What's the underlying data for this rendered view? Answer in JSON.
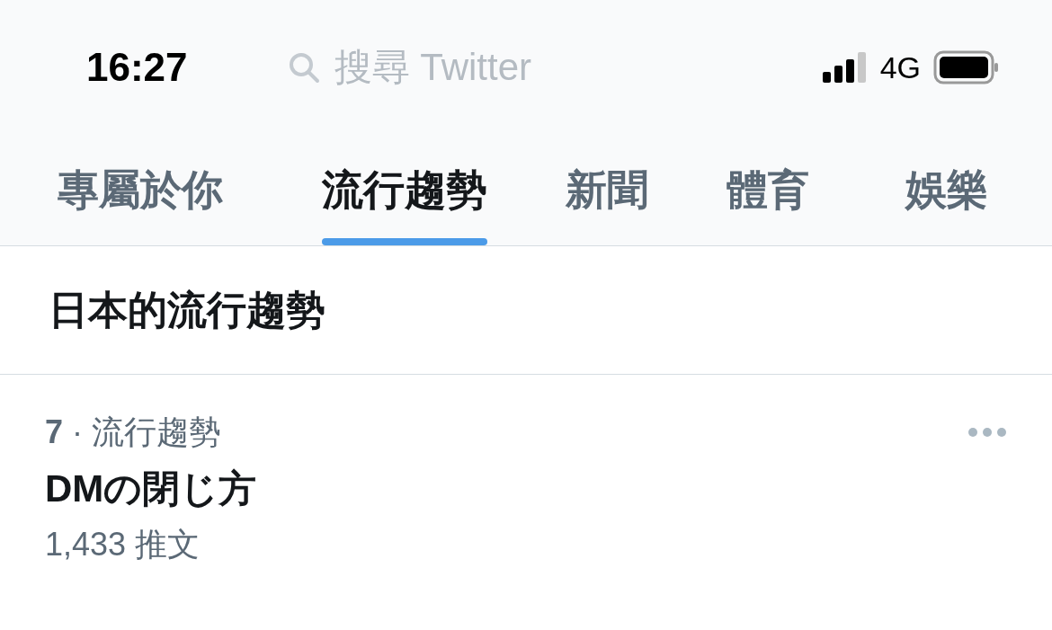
{
  "status_bar": {
    "time": "16:27",
    "network": "4G"
  },
  "search": {
    "placeholder": "搜尋 Twitter"
  },
  "tabs": [
    {
      "label": "專屬於你",
      "selected": false
    },
    {
      "label": "流行趨勢",
      "selected": true
    },
    {
      "label": "新聞",
      "selected": false
    },
    {
      "label": "體育",
      "selected": false
    },
    {
      "label": "娛樂",
      "selected": false
    }
  ],
  "section_title": "日本的流行趨勢",
  "trends": [
    {
      "context": "**7** · 流行趨勢",
      "title": "DMの閉じ方",
      "count": "1,433 推文"
    }
  ]
}
